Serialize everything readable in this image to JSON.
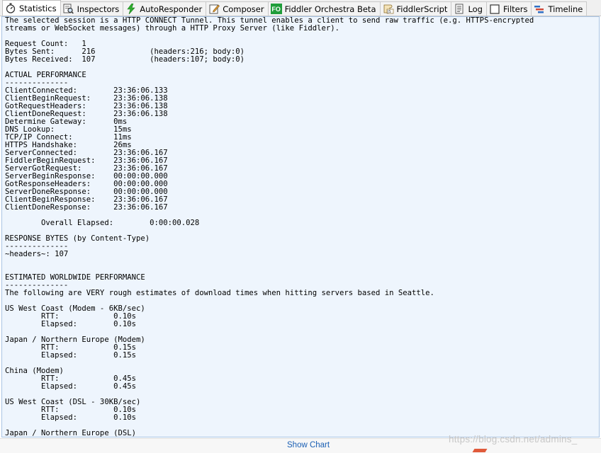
{
  "tabs": [
    {
      "label": "Statistics",
      "icon": "stopwatch-icon"
    },
    {
      "label": "Inspectors",
      "icon": "inspector-icon"
    },
    {
      "label": "AutoResponder",
      "icon": "lightning-icon"
    },
    {
      "label": "Composer",
      "icon": "compose-icon"
    },
    {
      "label": "Fiddler Orchestra Beta",
      "icon": "fo-icon",
      "icon_text": "FO"
    },
    {
      "label": "FiddlerScript",
      "icon": "script-icon"
    },
    {
      "label": "Log",
      "icon": "log-icon"
    },
    {
      "label": "Filters",
      "icon": "checkbox-icon"
    },
    {
      "label": "Timeline",
      "icon": "timeline-icon"
    }
  ],
  "report_text": "The selected session is a HTTP CONNECT Tunnel. This tunnel enables a client to send raw traffic (e.g. HTTPS-encrypted\nstreams or WebSocket messages) through a HTTP Proxy Server (like Fiddler).\n\nRequest Count:   1\nBytes Sent:      216\t\t(headers:216; body:0)\nBytes Received:  107\t\t(headers:107; body:0)\n\nACTUAL PERFORMANCE\n--------------\nClientConnected:\t23:36:06.133\nClientBeginRequest:\t23:36:06.138\nGotRequestHeaders:\t23:36:06.138\nClientDoneRequest:\t23:36:06.138\nDetermine Gateway:\t0ms\nDNS Lookup: \t\t15ms\nTCP/IP Connect:\t\t11ms\nHTTPS Handshake:\t26ms\nServerConnected:\t23:36:06.167\nFiddlerBeginRequest:\t23:36:06.167\nServerGotRequest:\t23:36:06.167\nServerBeginResponse:\t00:00:00.000\nGotResponseHeaders:\t00:00:00.000\nServerDoneResponse:\t00:00:00.000\nClientBeginResponse:\t23:36:06.167\nClientDoneResponse:\t23:36:06.167\n\n\tOverall Elapsed:\t0:00:00.028\n\nRESPONSE BYTES (by Content-Type)\n--------------\n~headers~: 107\n\n\nESTIMATED WORLDWIDE PERFORMANCE\n--------------\nThe following are VERY rough estimates of download times when hitting servers based in Seattle.\n\nUS West Coast (Modem - 6KB/sec)\n\tRTT:\t\t0.10s\n\tElapsed:\t0.10s\n\nJapan / Northern Europe (Modem)\n\tRTT:\t\t0.15s\n\tElapsed:\t0.15s\n\nChina (Modem)\n\tRTT:\t\t0.45s\n\tElapsed:\t0.45s\n\nUS West Coast (DSL - 30KB/sec)\n\tRTT:\t\t0.10s\n\tElapsed:\t0.10s\n\nJapan / Northern Europe (DSL)",
  "bottom": {
    "show_chart": "Show Chart"
  },
  "watermark": "https://blog.csdn.net/admins_",
  "colors": {
    "content_bg": "#eef5fd",
    "link": "#1a5fb4",
    "border": "#a9c4e4"
  }
}
